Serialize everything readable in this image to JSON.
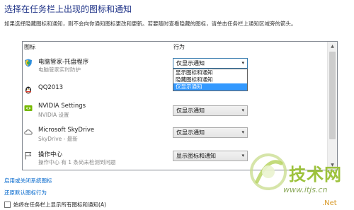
{
  "page": {
    "title": "选择在任务栏上出现的图标和通知",
    "description": "如果选择隐藏图标和通知，则不会向你通知图标更改和更新。若要随时查看隐藏的图标，请单击任务栏上通知区域旁的箭头。"
  },
  "table": {
    "col_icons": "图标",
    "col_behavior": "行为",
    "rows": [
      {
        "name": "电脑管家-托盘程序",
        "sub": "电脑管家实时防护",
        "behavior": "仅显示通知",
        "icon": "shield-icon",
        "open": true
      },
      {
        "name": "QQ2013",
        "sub": "",
        "behavior": "",
        "icon": "qq-icon",
        "open": false
      },
      {
        "name": "NVIDIA Settings",
        "sub": "NVIDIA 设置",
        "behavior": "仅显示通知",
        "icon": "nvidia-icon",
        "open": false
      },
      {
        "name": "Microsoft SkyDrive",
        "sub": "SkyDrive - 最新",
        "behavior": "仅显示通知",
        "icon": "cloud-icon",
        "open": false
      },
      {
        "name": "操作中心",
        "sub": "操作中心 有 1 条尚未检测到问题",
        "behavior": "显示图标和通知",
        "icon": "flag-icon",
        "open": false
      }
    ],
    "dropdown_options": [
      "显示图标和通知",
      "隐藏图标和通知",
      "仅显示通知"
    ],
    "dropdown_selected_index": 2
  },
  "links": {
    "system_icons": "启用或关闭系统图标",
    "restore_defaults": "还原默认图标行为"
  },
  "checkbox": {
    "label": "始终在任务栏上显示所有图标和通知(A)",
    "checked": false
  },
  "watermark": {
    "brand": "技术网",
    "url": "www.itjs.cn",
    "net": ".Net"
  },
  "colors": {
    "title": "#1e3287",
    "link": "#0066cc",
    "selection": "#3399ff",
    "watermark_green": "#9dc23c"
  }
}
